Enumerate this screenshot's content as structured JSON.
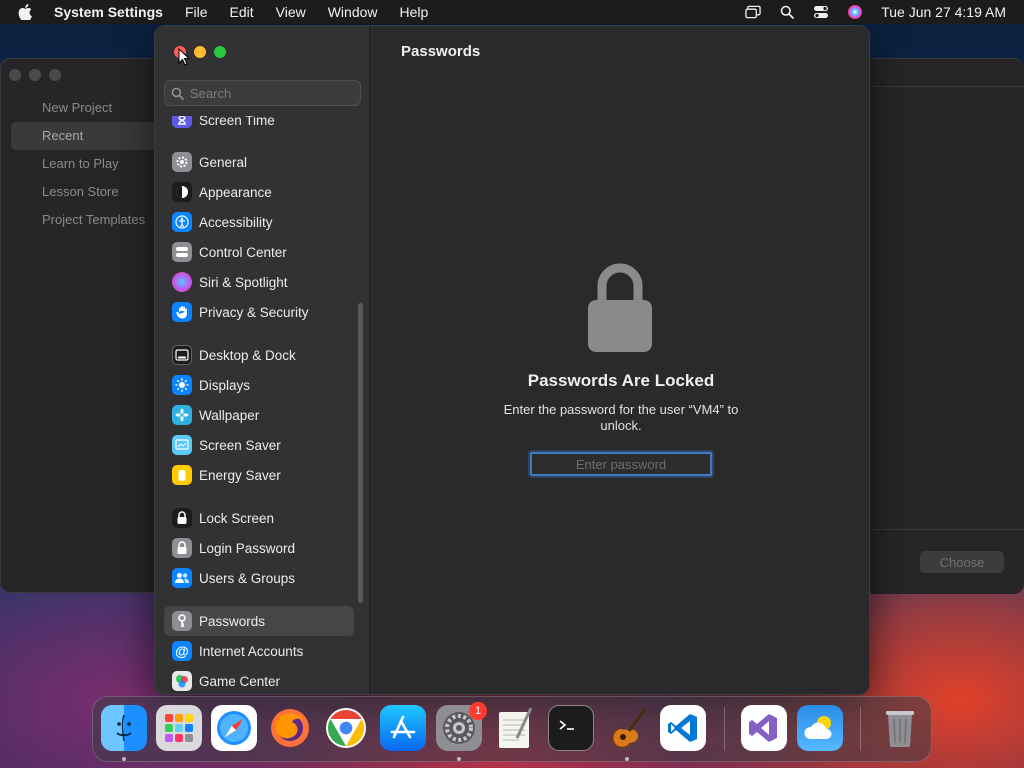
{
  "menubar": {
    "app_name": "System Settings",
    "menus": [
      "File",
      "Edit",
      "View",
      "Window",
      "Help"
    ],
    "clock": "Tue Jun 27  4:19 AM"
  },
  "background_window": {
    "sidebar_items": [
      "New Project",
      "Recent",
      "Learn to Play",
      "Lesson Store",
      "Project Templates"
    ],
    "selected_index": 1,
    "choose_label": "Choose"
  },
  "settings": {
    "search": {
      "placeholder": "Search",
      "value": ""
    },
    "sidebar": {
      "group0": [
        {
          "label": "Screen Time",
          "icon": "hourglass-icon",
          "color": "#5e5ce6"
        }
      ],
      "group1": [
        {
          "label": "General",
          "icon": "gear-icon",
          "color": "#8e8e93"
        },
        {
          "label": "Appearance",
          "icon": "appearance-icon",
          "color": "#1c1c1e"
        },
        {
          "label": "Accessibility",
          "icon": "accessibility-icon",
          "color": "#0a84ff"
        },
        {
          "label": "Control Center",
          "icon": "control-center-icon",
          "color": "#8e8e93"
        },
        {
          "label": "Siri & Spotlight",
          "icon": "siri-icon",
          "color": "#bf5af2"
        },
        {
          "label": "Privacy & Security",
          "icon": "hand-icon",
          "color": "#0a84ff"
        }
      ],
      "group2": [
        {
          "label": "Desktop & Dock",
          "icon": "dock-icon",
          "color": "#1c1c1e"
        },
        {
          "label": "Displays",
          "icon": "sun-icon",
          "color": "#0a84ff"
        },
        {
          "label": "Wallpaper",
          "icon": "flower-icon",
          "color": "#30b0e0"
        },
        {
          "label": "Screen Saver",
          "icon": "screen-saver-icon",
          "color": "#5ac8fa"
        },
        {
          "label": "Energy Saver",
          "icon": "battery-icon",
          "color": "#ffcc00"
        }
      ],
      "group3": [
        {
          "label": "Lock Screen",
          "icon": "lock-icon",
          "color": "#1c1c1e"
        },
        {
          "label": "Login Password",
          "icon": "padlock-icon",
          "color": "#8e8e93"
        },
        {
          "label": "Users & Groups",
          "icon": "users-icon",
          "color": "#0a84ff"
        }
      ],
      "group4": [
        {
          "label": "Passwords",
          "icon": "key-icon",
          "color": "#8e8e93",
          "selected": true
        },
        {
          "label": "Internet Accounts",
          "icon": "at-icon",
          "color": "#0a84ff"
        },
        {
          "label": "Game Center",
          "icon": "game-center-icon",
          "color": "#e8e8e8"
        }
      ]
    },
    "content": {
      "title": "Passwords",
      "locked_title": "Passwords Are Locked",
      "locked_message": "Enter the password for the user “VM4” to unlock.",
      "password_placeholder": "Enter password"
    }
  },
  "dock": {
    "apps": [
      {
        "name": "Finder",
        "icon": "finder-icon",
        "running": true
      },
      {
        "name": "Launchpad",
        "icon": "launchpad-icon",
        "running": false
      },
      {
        "name": "Safari",
        "icon": "safari-icon",
        "running": false
      },
      {
        "name": "Firefox",
        "icon": "firefox-icon",
        "running": false
      },
      {
        "name": "Chrome",
        "icon": "chrome-icon",
        "running": false
      },
      {
        "name": "App Store",
        "icon": "app-store-icon",
        "running": false
      },
      {
        "name": "System Settings",
        "icon": "system-settings-icon",
        "running": true,
        "badge": "1"
      },
      {
        "name": "TextEdit",
        "icon": "textedit-icon",
        "running": false
      },
      {
        "name": "Terminal",
        "icon": "terminal-icon",
        "running": false
      },
      {
        "name": "GarageBand",
        "icon": "garageband-icon",
        "running": true
      },
      {
        "name": "VS Code",
        "icon": "vscode-icon",
        "running": false
      },
      {
        "name": "Visual Studio",
        "icon": "visual-studio-icon",
        "running": false
      },
      {
        "name": "Weather",
        "icon": "weather-icon",
        "running": false
      },
      {
        "name": "Trash",
        "icon": "trash-icon",
        "running": false
      }
    ]
  }
}
